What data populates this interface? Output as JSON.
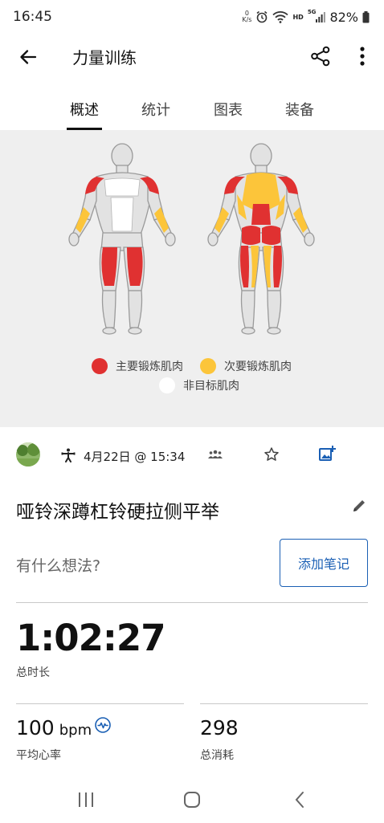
{
  "status_bar": {
    "time": "16:45",
    "net_speed_value": "0",
    "net_speed_unit": "K/s",
    "hd": "HD",
    "network": "5G",
    "battery": "82%"
  },
  "app_bar": {
    "title": "力量训练"
  },
  "tabs": [
    {
      "label": "概述",
      "active": true
    },
    {
      "label": "统计",
      "active": false
    },
    {
      "label": "图表",
      "active": false
    },
    {
      "label": "装备",
      "active": false
    }
  ],
  "muscle_map": {
    "legend": {
      "primary": "主要锻炼肌肉",
      "secondary": "次要锻炼肌肉",
      "non_target": "非目标肌肉"
    },
    "colors": {
      "primary": "#e03131",
      "secondary": "#fcc53a",
      "non_target": "#ffffff",
      "body_fill": "#e2e2e2",
      "body_stroke": "#9a9a9a",
      "panel_bg": "#efefef"
    }
  },
  "activity": {
    "date": "4月22日 @ 15:34",
    "title": "哑铃深蹲杠铃硬拉侧平举"
  },
  "notes": {
    "placeholder": "有什么想法?",
    "add_button": "添加笔记"
  },
  "stats": {
    "duration": {
      "value": "1:02:27",
      "label": "总时长"
    },
    "heart_rate": {
      "value": "100",
      "unit": "bpm",
      "label": "平均心率"
    },
    "calories": {
      "value": "298",
      "label": "总消耗"
    }
  },
  "accent_color": "#1a5fb4"
}
